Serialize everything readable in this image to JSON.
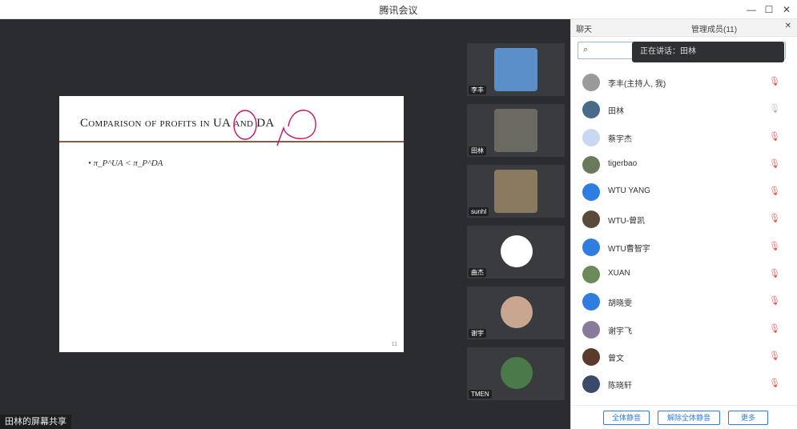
{
  "window": {
    "title": "腾讯会议"
  },
  "slide": {
    "title": "Comparison of profits in UA and DA",
    "bullet": "π",
    "bullet_text": "• π_P^UA < π_P^DA",
    "page": "11"
  },
  "share_bar": {
    "label": "田林的屏幕共享"
  },
  "videos": [
    {
      "name": "李丰",
      "kind": "camera",
      "color": "#5a8fc9"
    },
    {
      "name": "田林",
      "kind": "camera",
      "color": "#6b6a62"
    },
    {
      "name": "sunhl",
      "kind": "camera",
      "color": "#8a7a60"
    },
    {
      "name": "曲杰",
      "kind": "avatar",
      "color": "#8b5a2b"
    },
    {
      "name": "谢宇",
      "kind": "avatar",
      "color": "#c9a690"
    },
    {
      "name": "TMEN",
      "kind": "avatar",
      "color": "#4a7a4a"
    }
  ],
  "panel": {
    "tab_chat": "聊天",
    "tab_members": "管理成员(11)",
    "search_placeholder": "",
    "toast": "正在讲话：田林",
    "participants": [
      {
        "name": "李丰(主持人, 我)",
        "sub": "主持人",
        "avatar_color": "#9a9a9a",
        "muted": true
      },
      {
        "name": "田林",
        "sub": "",
        "avatar_color": "#4a6a8a",
        "muted": false
      },
      {
        "name": "蔡宇杰",
        "sub": "",
        "avatar_color": "#c9d8f0",
        "muted": true
      },
      {
        "name": "tigerbao",
        "sub": "",
        "avatar_color": "#6b7a5a",
        "muted": true
      },
      {
        "name": "WTU YANG",
        "sub": "",
        "avatar_color": "#2f7de1",
        "muted": true
      },
      {
        "name": "WTU-曾凯",
        "sub": "",
        "avatar_color": "#5a4a3a",
        "muted": true
      },
      {
        "name": "WTU曹智宇",
        "sub": "",
        "avatar_color": "#2f7de1",
        "muted": true
      },
      {
        "name": "XUAN",
        "sub": "",
        "avatar_color": "#6a8a5a",
        "muted": true
      },
      {
        "name": "胡晓雯",
        "sub": "",
        "avatar_color": "#2f7de1",
        "muted": true
      },
      {
        "name": "谢宇飞",
        "sub": "",
        "avatar_color": "#8a7a9a",
        "muted": true
      },
      {
        "name": "曾文",
        "sub": "",
        "avatar_color": "#5a3a2a",
        "muted": true
      },
      {
        "name": "陈晓轩",
        "sub": "",
        "avatar_color": "#3a4a6a",
        "muted": true
      }
    ],
    "btn_mute_all": "全体静音",
    "btn_unmute_all": "解除全体静音",
    "btn_more": "更多"
  }
}
